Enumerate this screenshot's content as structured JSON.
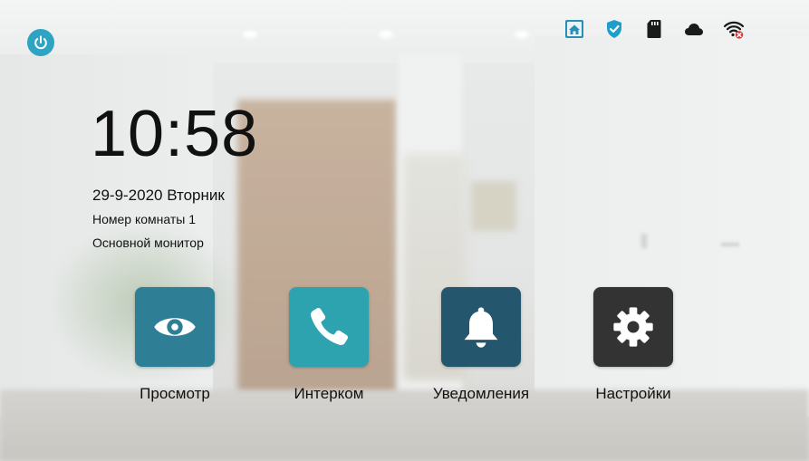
{
  "clock": {
    "time": "10:58",
    "date": "29-9-2020 Вторник",
    "room": "Номер комнаты 1",
    "monitor": "Основной монитор"
  },
  "status_bar": {
    "icons": [
      "home-icon",
      "shield-check-icon",
      "sd-card-icon",
      "cloud-icon",
      "wifi-disconnected-icon"
    ]
  },
  "power": {
    "icon": "power-icon",
    "color": "#2ea3c2"
  },
  "apps": [
    {
      "label": "Просмотр",
      "icon": "eye-icon",
      "color": "#2e7f96"
    },
    {
      "label": "Интерком",
      "icon": "phone-icon",
      "color": "#2ea3b0"
    },
    {
      "label": "Уведомления",
      "icon": "bell-icon",
      "color": "#24576e"
    },
    {
      "label": "Настройки",
      "icon": "gear-icon",
      "color": "#333333"
    }
  ]
}
